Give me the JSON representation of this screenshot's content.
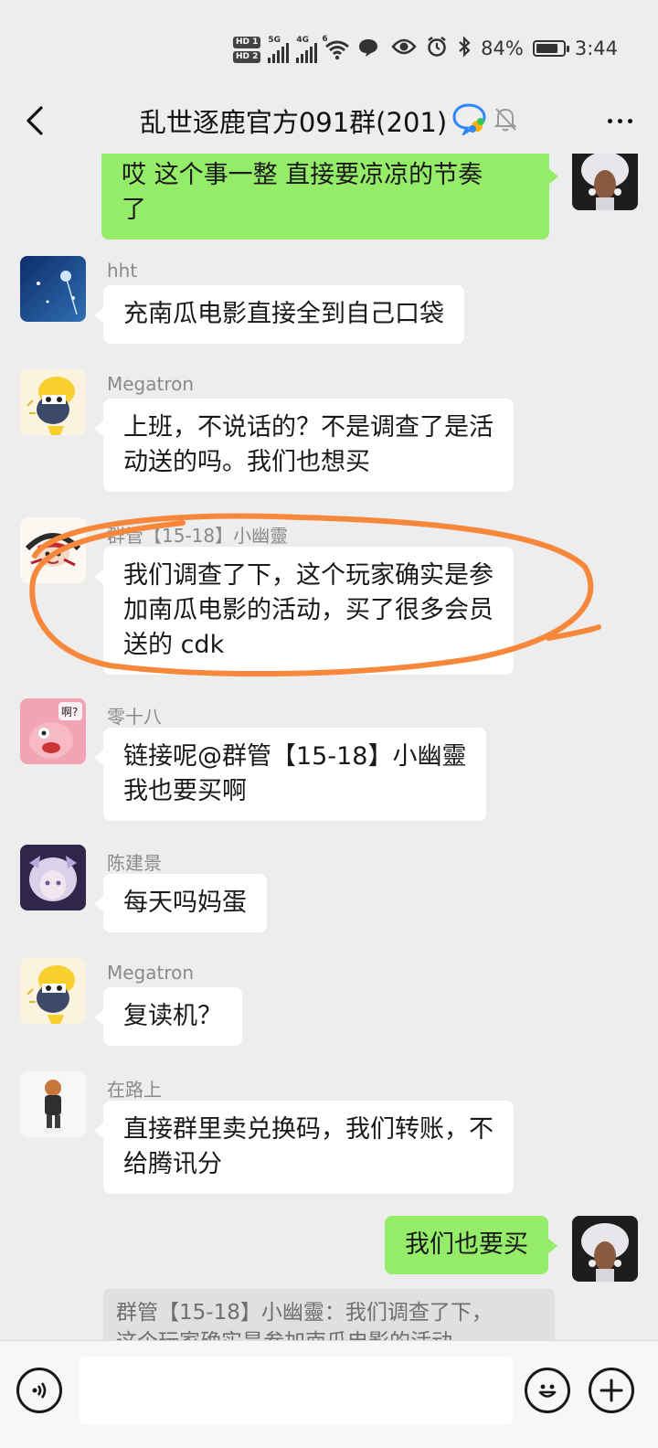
{
  "status_bar": {
    "hd1": "HD 1",
    "hd2": "HD 2",
    "net1": "5G",
    "net2": "4G",
    "wifi_gen": "6",
    "battery_text": "84%",
    "battery_level": 0.84,
    "time": "3:44",
    "icons": [
      "eye-icon",
      "alarm-icon",
      "bluetooth-icon",
      "message-bubble-icon"
    ]
  },
  "header": {
    "title": "乱世逐鹿官方091群(201)",
    "back_icon": "chevron-left-icon",
    "more_icon": "more-dots-icon",
    "muted": true
  },
  "messages": [
    {
      "id": "m0",
      "side": "right",
      "sender": "",
      "lines": [
        "哎 这个事一整  直接要凉凉的节奏",
        "了"
      ]
    },
    {
      "id": "m1",
      "side": "left",
      "sender": "hht",
      "lines": [
        "充南瓜电影直接全到自己口袋"
      ]
    },
    {
      "id": "m2",
      "side": "left",
      "sender": "Megatron",
      "lines": [
        "上班，不说话的？不是调查了是活",
        "动送的吗。我们也想买"
      ]
    },
    {
      "id": "m3",
      "side": "left",
      "sender": "群管【15-18】小幽靈",
      "lines": [
        "我们调查了下，这个玩家确实是参",
        "加南瓜电影的活动，买了很多会员",
        "送的 cdk"
      ]
    },
    {
      "id": "m4",
      "side": "left",
      "sender": "零十八",
      "lines": [
        "链接呢@群管【15-18】小幽靈",
        "我也要买啊"
      ]
    },
    {
      "id": "m5",
      "side": "left",
      "sender": "陈建景",
      "lines": [
        "每天吗妈蛋"
      ]
    },
    {
      "id": "m6",
      "side": "left",
      "sender": "Megatron",
      "lines": [
        "复读机？"
      ]
    },
    {
      "id": "m7",
      "side": "left",
      "sender": "在路上",
      "lines": [
        "直接群里卖兑换码，我们转账，不",
        "给腾讯分"
      ]
    },
    {
      "id": "m8",
      "side": "right",
      "sender": "",
      "lines": [
        "我们也要买"
      ]
    }
  ],
  "quote": {
    "lines": [
      "群管【15-18】小幽靈：我们调查了下，",
      "这个玩家确实是参加南瓜电影的活动，"
    ]
  },
  "avatar_badge_text": "啊?",
  "annotation": {
    "color": "#f7883b",
    "target": "m3"
  },
  "input_bar": {
    "voice_icon": "voice-icon",
    "input_value": "",
    "emoji_icon": "emoji-icon",
    "plus_icon": "plus-icon"
  },
  "colors": {
    "background": "#ededed",
    "my_bubble": "#95ec69",
    "other_bubble": "#ffffff",
    "sender_name": "#8a8a8a",
    "annotation": "#f7883b"
  }
}
